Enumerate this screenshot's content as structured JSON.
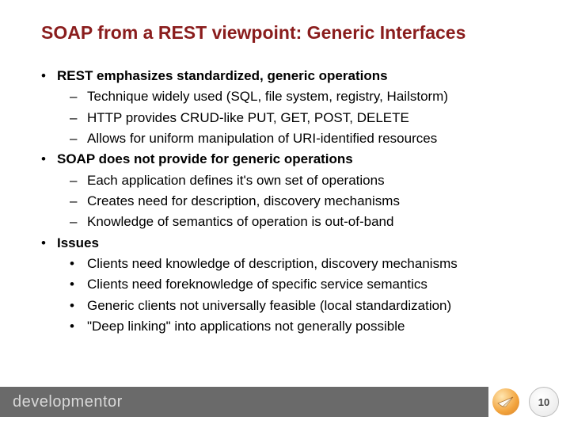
{
  "title": "SOAP from a REST viewpoint: Generic Interfaces",
  "bullets": [
    {
      "text": "REST emphasizes standardized, generic operations",
      "bold": true,
      "children": [
        {
          "marker": "dash",
          "text": "Technique widely used (SQL, file system, registry, Hailstorm)"
        },
        {
          "marker": "dash",
          "text": "HTTP provides CRUD-like PUT, GET, POST, DELETE"
        },
        {
          "marker": "dash",
          "text": "Allows for uniform manipulation of URI-identified resources"
        }
      ]
    },
    {
      "text": "SOAP does not provide for generic operations",
      "bold": true,
      "children": [
        {
          "marker": "dash",
          "text": "Each application defines it's own set of operations"
        },
        {
          "marker": "dash",
          "text": "Creates need for description, discovery mechanisms"
        },
        {
          "marker": "dash",
          "text": "Knowledge of semantics of operation is out-of-band"
        }
      ]
    },
    {
      "text": "Issues",
      "bold": true,
      "children": [
        {
          "marker": "dot",
          "text": "Clients need knowledge of description, discovery mechanisms"
        },
        {
          "marker": "dot",
          "text": "Clients need foreknowledge of specific service semantics"
        },
        {
          "marker": "dot",
          "text": "Generic clients not universally feasible (local standardization)"
        },
        {
          "marker": "dot",
          "text": "\"Deep linking\" into applications not generally possible"
        }
      ]
    }
  ],
  "footer": {
    "brand": "developmentor",
    "page": "10",
    "iconName": "paper-plane-icon"
  }
}
